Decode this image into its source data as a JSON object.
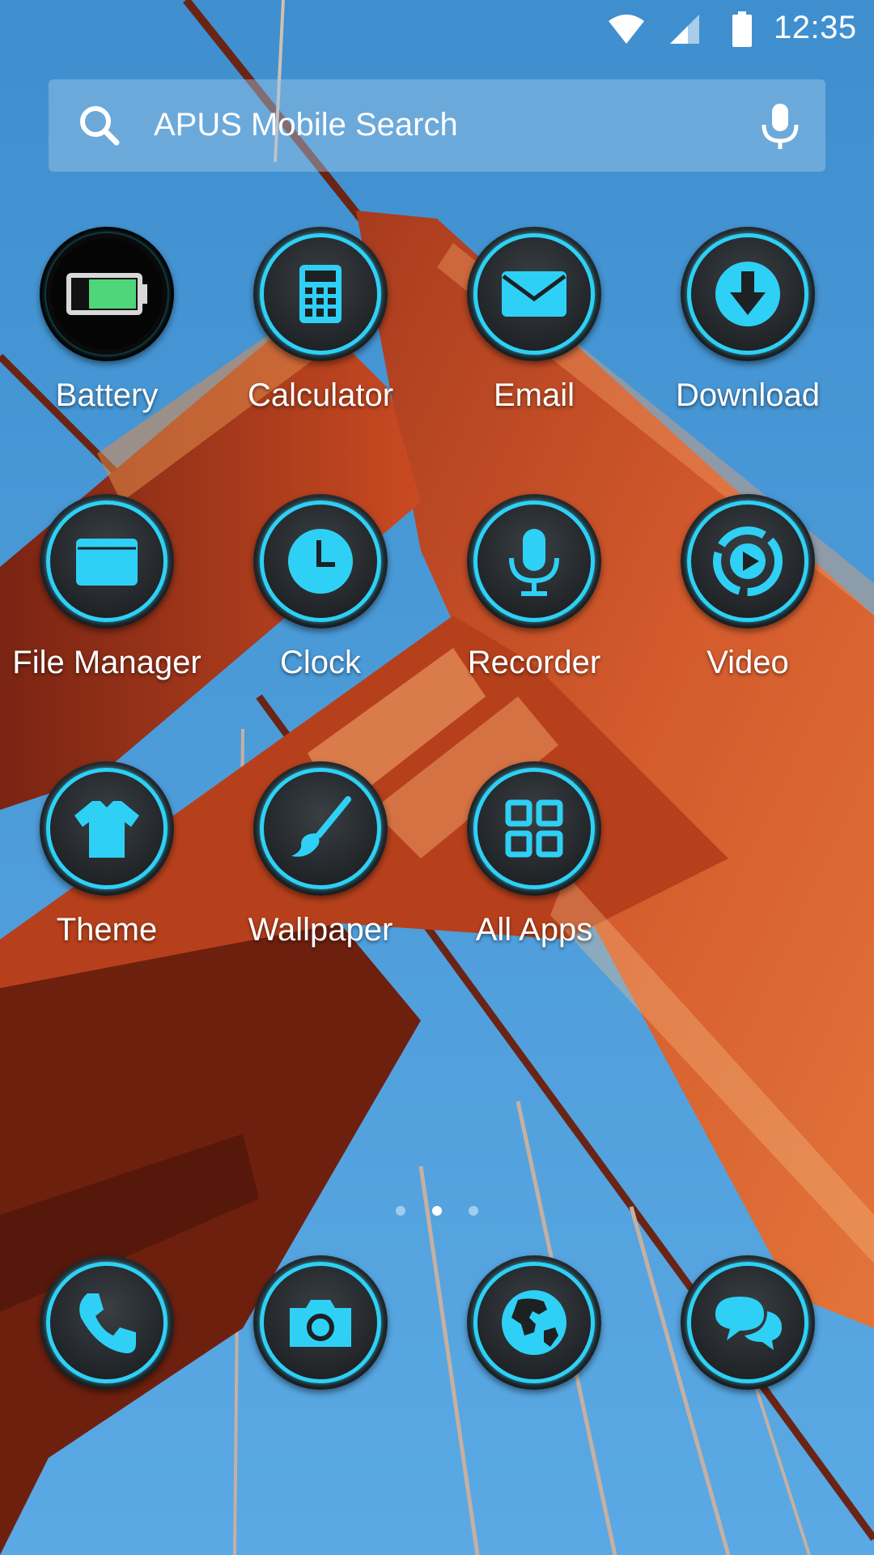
{
  "status_bar": {
    "time": "12:35"
  },
  "search": {
    "placeholder": "APUS Mobile Search"
  },
  "apps": [
    {
      "label": "Battery",
      "icon": "battery-icon"
    },
    {
      "label": "Calculator",
      "icon": "calculator-icon"
    },
    {
      "label": "Email",
      "icon": "envelope-icon"
    },
    {
      "label": "Download",
      "icon": "download-icon"
    },
    {
      "label": "File Manager",
      "icon": "folder-icon"
    },
    {
      "label": "Clock",
      "icon": "clock-icon"
    },
    {
      "label": "Recorder",
      "icon": "microphone-icon"
    },
    {
      "label": "Video",
      "icon": "play-icon"
    },
    {
      "label": "Theme",
      "icon": "tshirt-icon"
    },
    {
      "label": "Wallpaper",
      "icon": "paintbrush-icon"
    },
    {
      "label": "All Apps",
      "icon": "grid-icon"
    }
  ],
  "dock": [
    {
      "icon": "phone-icon"
    },
    {
      "icon": "camera-icon"
    },
    {
      "icon": "globe-icon"
    },
    {
      "icon": "chat-bubbles-icon"
    }
  ],
  "page_indicator": {
    "pages": 3,
    "current": 2
  },
  "colors": {
    "accent": "#2fd0f5",
    "icon_ring": "#1d2124",
    "sky": "#4a9bd8",
    "bridge": "#c8451e"
  }
}
